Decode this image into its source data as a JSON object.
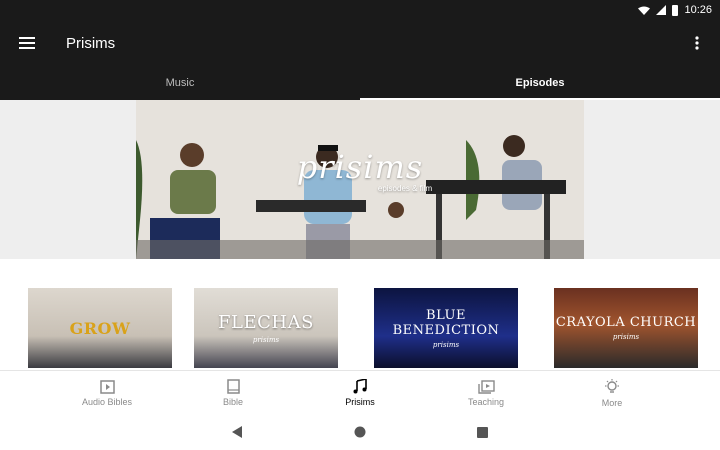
{
  "status_bar": {
    "time": "10:26",
    "icons": [
      "wifi-icon",
      "cell-signal-icon",
      "battery-icon"
    ]
  },
  "app_bar": {
    "title": "Prisims",
    "menu_icon": "menu-icon",
    "overflow_icon": "more-vert-icon"
  },
  "tabs": [
    {
      "label": "Music",
      "active": false
    },
    {
      "label": "Episodes",
      "active": true
    }
  ],
  "hero": {
    "title": "prisims",
    "subtitle": "episodes & film"
  },
  "cards": [
    {
      "title": "GROW",
      "subtitle": ""
    },
    {
      "title": "FLECHAS",
      "subtitle": "prisims"
    },
    {
      "title": "BLUE BENEDICTION",
      "subtitle": "prisims"
    },
    {
      "title": "CRAYOLA CHURCH",
      "subtitle": "prisims"
    }
  ],
  "bottom_nav": [
    {
      "label": "Audio Bibles",
      "icon": "play-box-icon",
      "active": false
    },
    {
      "label": "Bible",
      "icon": "book-icon",
      "active": false
    },
    {
      "label": "Prisims",
      "icon": "music-note-icon",
      "active": true
    },
    {
      "label": "Teaching",
      "icon": "video-library-icon",
      "active": false
    },
    {
      "label": "More",
      "icon": "lightbulb-icon",
      "active": false
    }
  ],
  "system_nav": [
    "back-icon",
    "home-icon",
    "recents-icon"
  ],
  "colors": {
    "app_bar_bg": "#1a1a1a",
    "active_text": "#000000",
    "inactive_text": "#8a8a8a"
  }
}
